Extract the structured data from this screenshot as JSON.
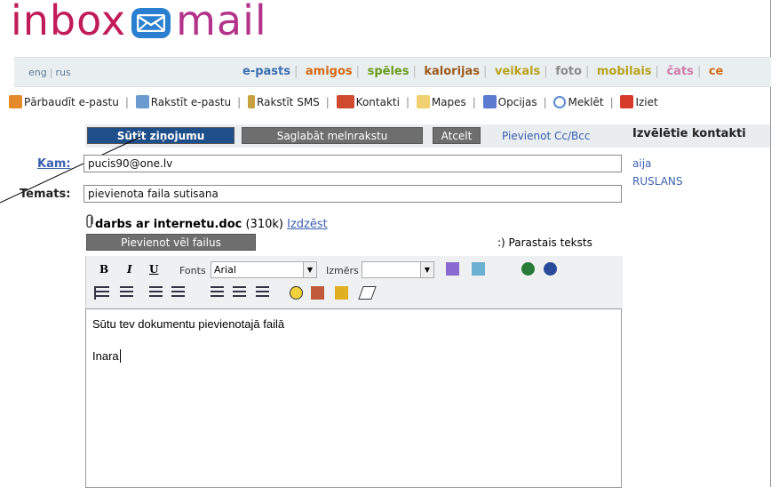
{
  "logo": {
    "part1": "inbox",
    "part2": "mail"
  },
  "nav": {
    "langs": [
      "eng",
      "rus"
    ],
    "tabs": [
      {
        "label": "e-pasts",
        "color": "#3a6fb0"
      },
      {
        "label": "amigos",
        "color": "#d46a14"
      },
      {
        "label": "spēles",
        "color": "#6a9c1c"
      },
      {
        "label": "kalorijas",
        "color": "#9a5a1c"
      },
      {
        "label": "veikals",
        "color": "#b8a21c"
      },
      {
        "label": "foto",
        "color": "#8a8a8a"
      },
      {
        "label": "mobilais",
        "color": "#b8a21c"
      },
      {
        "label": "čats",
        "color": "#d07aa8"
      },
      {
        "label": "ce",
        "color": "#d46a14"
      }
    ]
  },
  "toolbar": {
    "check": "Pārbaudīt e-pastu",
    "compose": "Rakstīt e-pastu",
    "sms": "Rakstīt SMS",
    "contacts": "Kontakti",
    "folders": "Mapes",
    "options": "Opcijas",
    "search": "Meklēt",
    "logout": "Iziet"
  },
  "actions": {
    "send": "Sūtīt ziņojumu",
    "save_draft": "Saglabāt melnrakstu",
    "cancel": "Atcelt",
    "add_cc": "Pievienot Cc/Bcc"
  },
  "contacts_panel": {
    "title": "Izvēlētie kontakti",
    "items": [
      "aija",
      "RUSLANS"
    ]
  },
  "form": {
    "to_label": "Kam:",
    "to_value": "pucis90@one.lv",
    "subject_label": "Temats:",
    "subject_value": "pievienota faila sutisana",
    "attachment_name": "darbs ar internetu.doc",
    "attachment_size": "(310k)",
    "remove": "Izdzēst",
    "add_more": "Pievienot vēl failus",
    "plain_text": ":) Parastais teksts"
  },
  "editor": {
    "bold": "B",
    "italic": "I",
    "underline": "U",
    "font_label": "Fonts",
    "font_value": "Arial",
    "size_label": "Izmērs",
    "size_value": "",
    "body_line1": "Sūtu tev dokumentu pievienotajā failā",
    "body_line2": "Inara"
  }
}
